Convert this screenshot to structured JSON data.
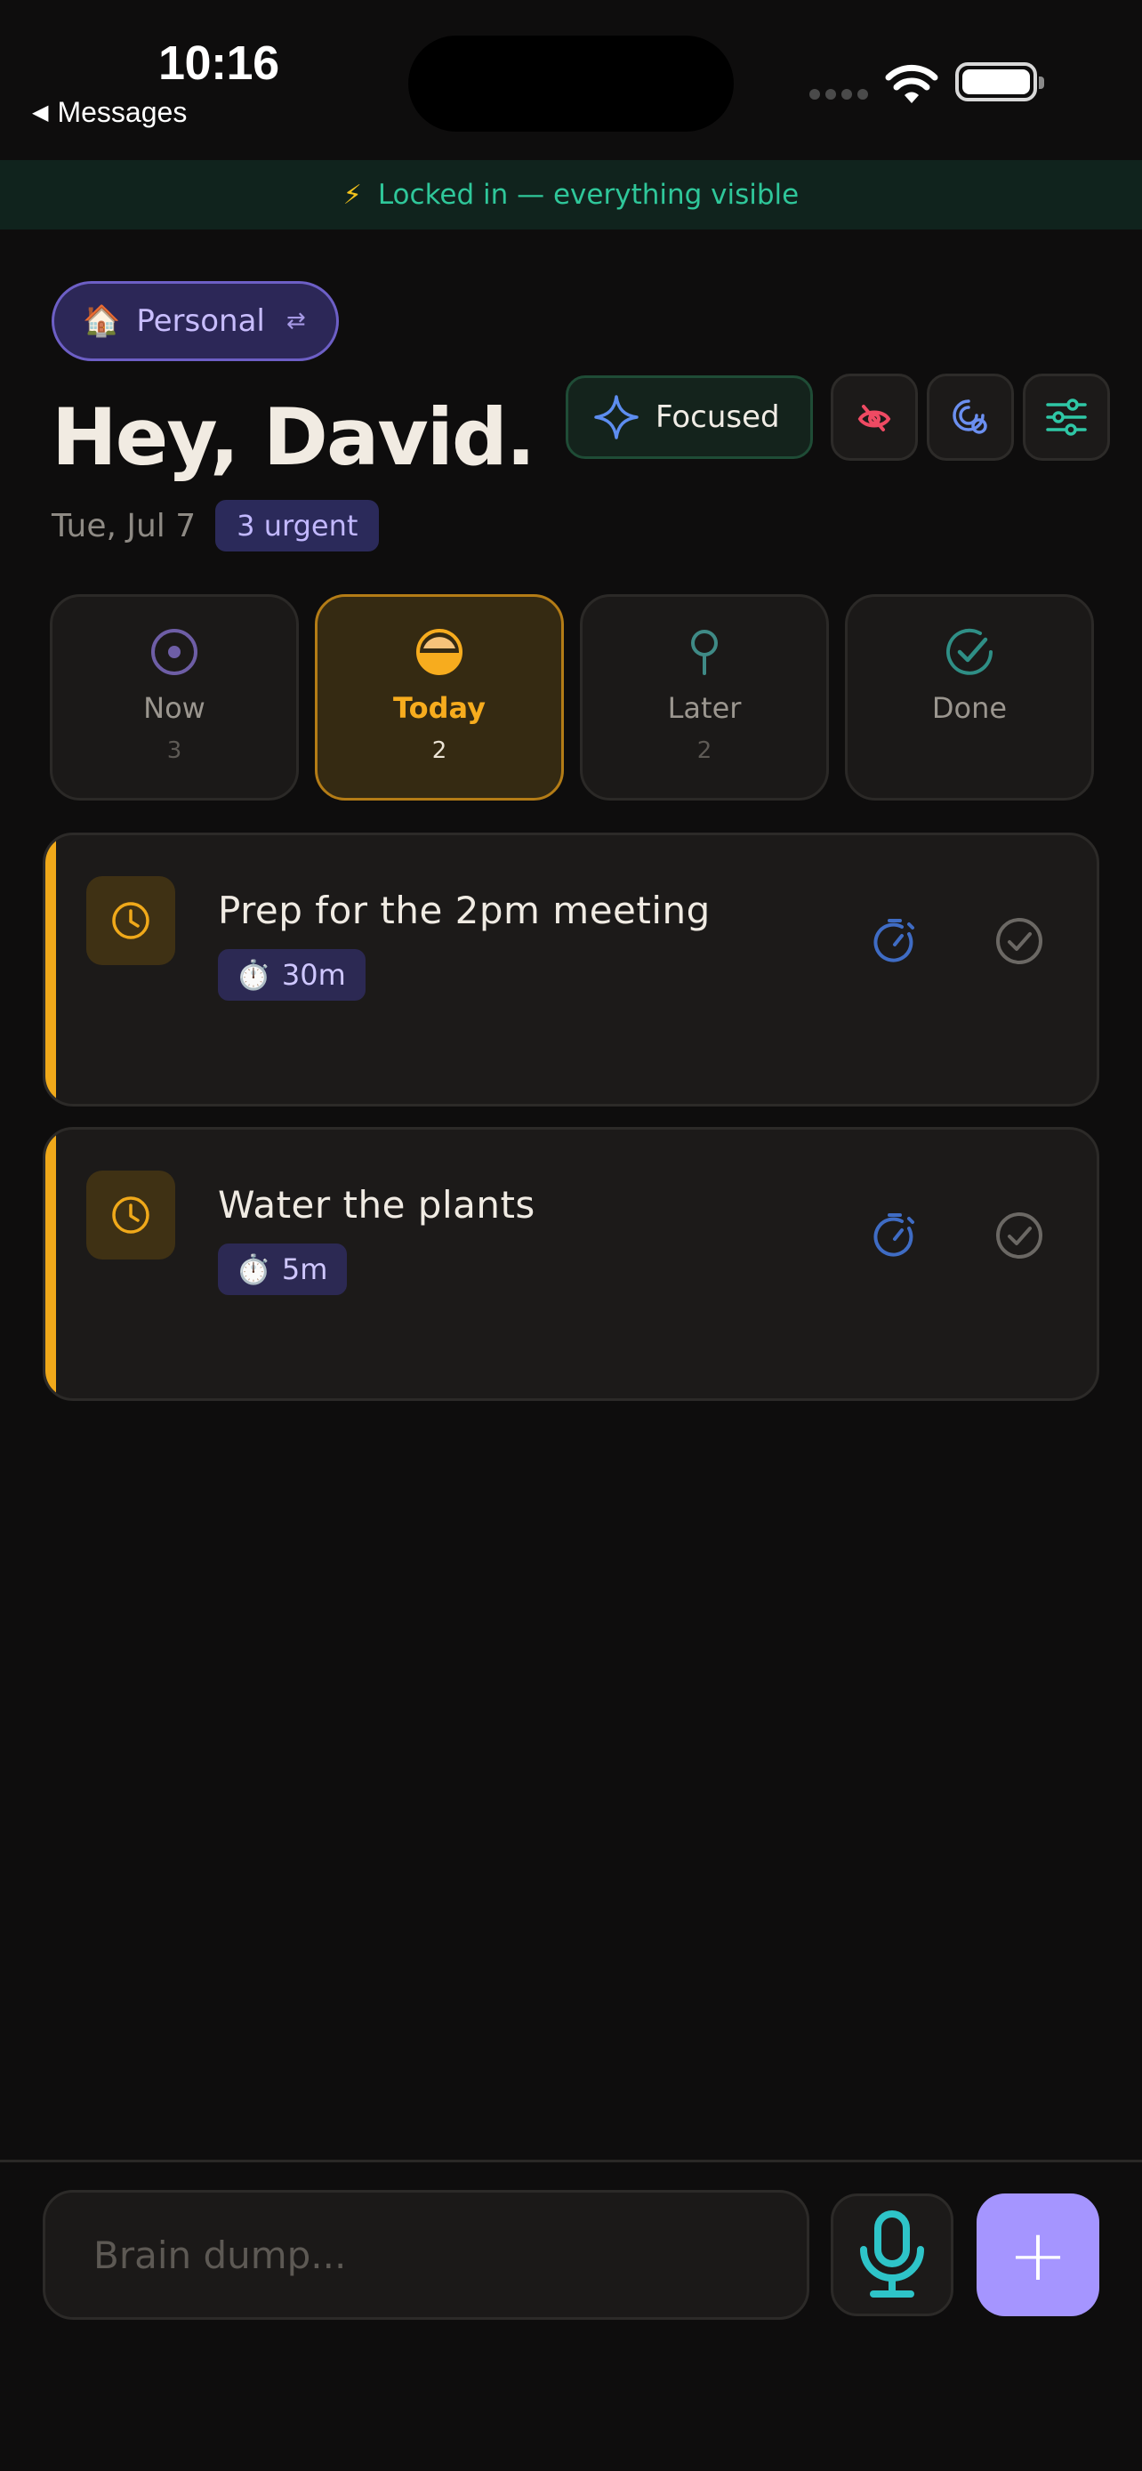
{
  "status_bar": {
    "time": "10:16",
    "back_label": "Messages",
    "back_arrow": "◀"
  },
  "banner": {
    "icon": "⚡",
    "text": "Locked in — everything visible"
  },
  "workspace": {
    "icon": "🏠",
    "label": "Personal",
    "swap_icon": "⇄"
  },
  "header": {
    "greeting": "Hey, David.",
    "date": "Tue, Jul 7",
    "urgent_badge": "3 urgent"
  },
  "actions": {
    "focused_label": "Focused"
  },
  "tabs": [
    {
      "label": "Now",
      "count": "3",
      "icon": "target-icon",
      "active": false
    },
    {
      "label": "Today",
      "count": "2",
      "icon": "half-sun-icon",
      "active": true
    },
    {
      "label": "Later",
      "count": "2",
      "icon": "pin-icon",
      "active": false
    },
    {
      "label": "Done",
      "count": "",
      "icon": "check-circle-icon",
      "active": false
    }
  ],
  "tasks": [
    {
      "title": "Prep for the 2pm meeting",
      "duration": "30m",
      "duration_icon": "⏱️"
    },
    {
      "title": "Water the plants",
      "duration": "5m",
      "duration_icon": "⏱️"
    }
  ],
  "composer": {
    "placeholder": "Brain dump...",
    "value": "",
    "add_label": "+"
  },
  "colors": {
    "accent_purple": "#a595ff",
    "accent_amber": "#f0a91a",
    "accent_green": "#2fc79a",
    "background": "#0e0d0d"
  }
}
